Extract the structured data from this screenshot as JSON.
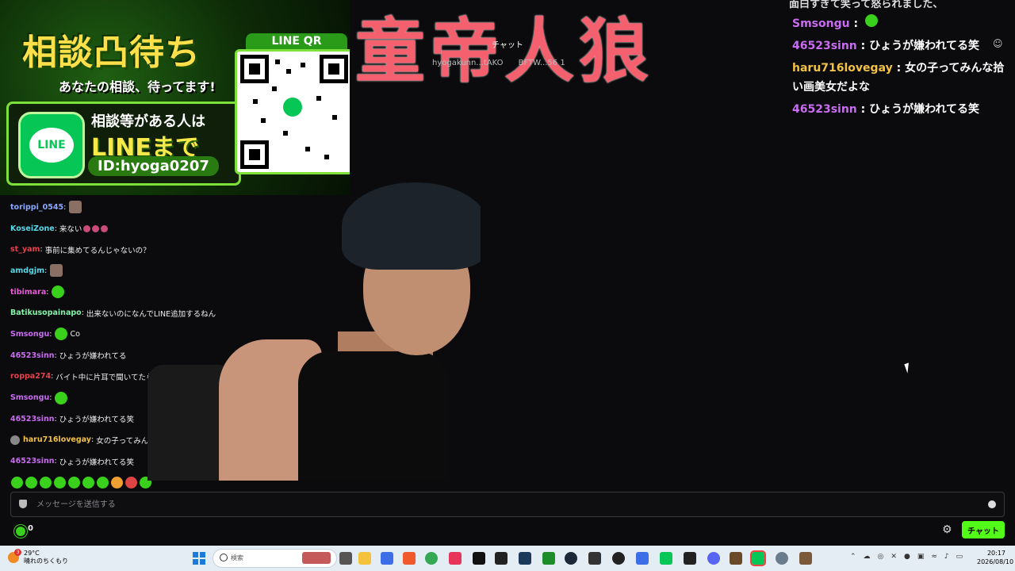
{
  "promo": {
    "headline": "相談凸待ち",
    "subtitle": "あなたの相談、待ってます!",
    "line_text_1": "相談等がある人は",
    "line_text_2": "LINEまで",
    "line_id": "ID:hyoga0207",
    "qr_label": "LINE QR",
    "line_logo": "LINE"
  },
  "stream_title": "童帝人狼",
  "center_strip": {
    "label": "チャット",
    "gifters": [
      "hyogakunn...tAKO",
      "BFTW...56 1"
    ]
  },
  "chat": [
    {
      "user": "torippi_0545",
      "color": "#8aa7ff",
      "text": "",
      "emotes": [
        "sq"
      ]
    },
    {
      "user": "KoseiZone",
      "color": "#57d8e8",
      "text": "来ない",
      "emotes": [
        "sm",
        "sm",
        "sm"
      ]
    },
    {
      "user": "st_yam",
      "color": "#e8414d",
      "text": "事前に集めてるんじゃないの？",
      "emotes": []
    },
    {
      "user": "amdgjm",
      "color": "#57d8e8",
      "text": "",
      "emotes": [
        "sq"
      ]
    },
    {
      "user": "tibimara",
      "color": "#e85ad8",
      "text": "",
      "emotes": [
        "g"
      ]
    },
    {
      "user": "Batikusopainapo",
      "color": "#84f0a8",
      "text": "出来ないのになんでLINE追加するねん",
      "emotes": []
    },
    {
      "user": "Smsongu",
      "color": "#c86cf0",
      "text": "Co",
      "emotes": [
        "g"
      ]
    },
    {
      "user": "46523sinn",
      "color": "#c86cf0",
      "text": "ひょうが嫌われてる",
      "emotes": []
    },
    {
      "user": "roppa274",
      "color": "#e8414d",
      "text": "バイト中に片耳で聞いてたら言",
      "emotes": []
    },
    {
      "user": "Smsongu",
      "color": "#c86cf0",
      "text": "",
      "emotes": [
        "g"
      ]
    },
    {
      "user": "46523sinn",
      "color": "#c86cf0",
      "text": "ひょうが嫌われてる笑",
      "emotes": []
    },
    {
      "user": "haru716lovegay",
      "color": "#f3c244",
      "text": "女の子ってみんな拾",
      "emotes": [],
      "avatar": true
    },
    {
      "user": "46523sinn",
      "color": "#c86cf0",
      "text": "ひょうが嫌われてる笑",
      "emotes": []
    }
  ],
  "overlay": {
    "top_text": "面白すぎて笑って怒られました、",
    "messages": [
      {
        "user": "Smsongu",
        "user_class": "u-pur",
        "text": ""
      },
      {
        "user": "46523sinn",
        "user_class": "u-pur",
        "text": "ひょうが嫌われてる笑"
      },
      {
        "user": "haru716lovegay",
        "user_class": "u-org",
        "text": "女の子ってみんな拾い画美女だよな"
      },
      {
        "user": "46523sinn",
        "user_class": "u-pur",
        "text": "ひょうが嫌われてる笑"
      }
    ],
    "separator": " : "
  },
  "input": {
    "placeholder": "メッセージを送信する"
  },
  "points": "0",
  "chat_button": "チャット",
  "taskbar": {
    "weather_temp": "29°C",
    "weather_desc": "晴れのちくもり",
    "weather_badge": "3",
    "search_placeholder": "検索",
    "time": "20:17",
    "date": "2026/08/10"
  },
  "colors": {
    "accent": "#53fc18",
    "title_color": "#f4606e",
    "background": "#0b0b0d"
  }
}
